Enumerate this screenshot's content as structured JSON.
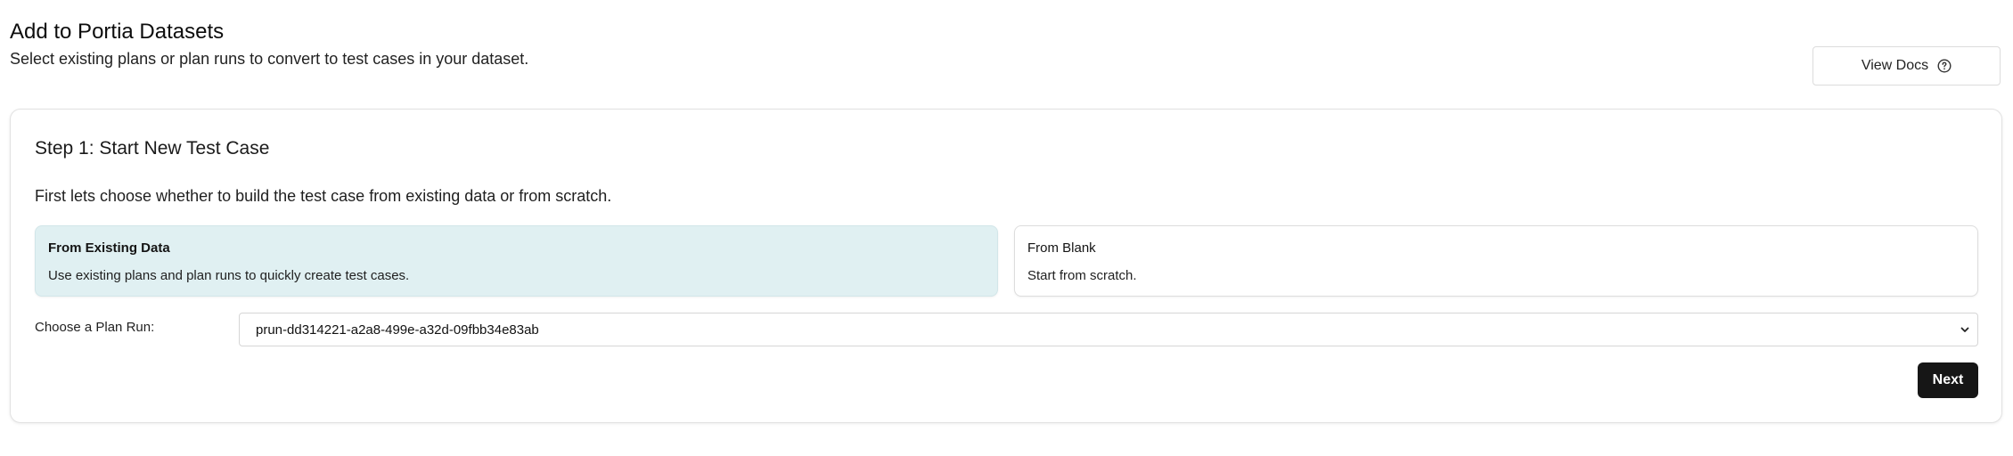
{
  "header": {
    "title": "Add to Portia Datasets",
    "subtitle": "Select existing plans or plan runs to convert to test cases in your dataset.",
    "docs_button_label": "View Docs",
    "docs_icon": "help-circle-icon"
  },
  "step": {
    "title": "Step 1: Start New Test Case",
    "description": "First lets choose whether to build the test case from existing data or from scratch.",
    "options": [
      {
        "title": "From Existing Data",
        "description": "Use existing plans and plan runs to quickly create test cases.",
        "selected": true
      },
      {
        "title": "From Blank",
        "description": "Start from scratch.",
        "selected": false
      }
    ],
    "plan_run_label": "Choose a Plan Run:",
    "plan_run_value": "prun-dd314221-a2a8-499e-a32d-09fbb34e83ab",
    "select_icon": "chevron-down-icon",
    "next_button_label": "Next"
  },
  "colors": {
    "selected_option_bg": "#e0f0f2",
    "primary_button_bg": "#161616",
    "primary_button_text": "#ffffff"
  }
}
